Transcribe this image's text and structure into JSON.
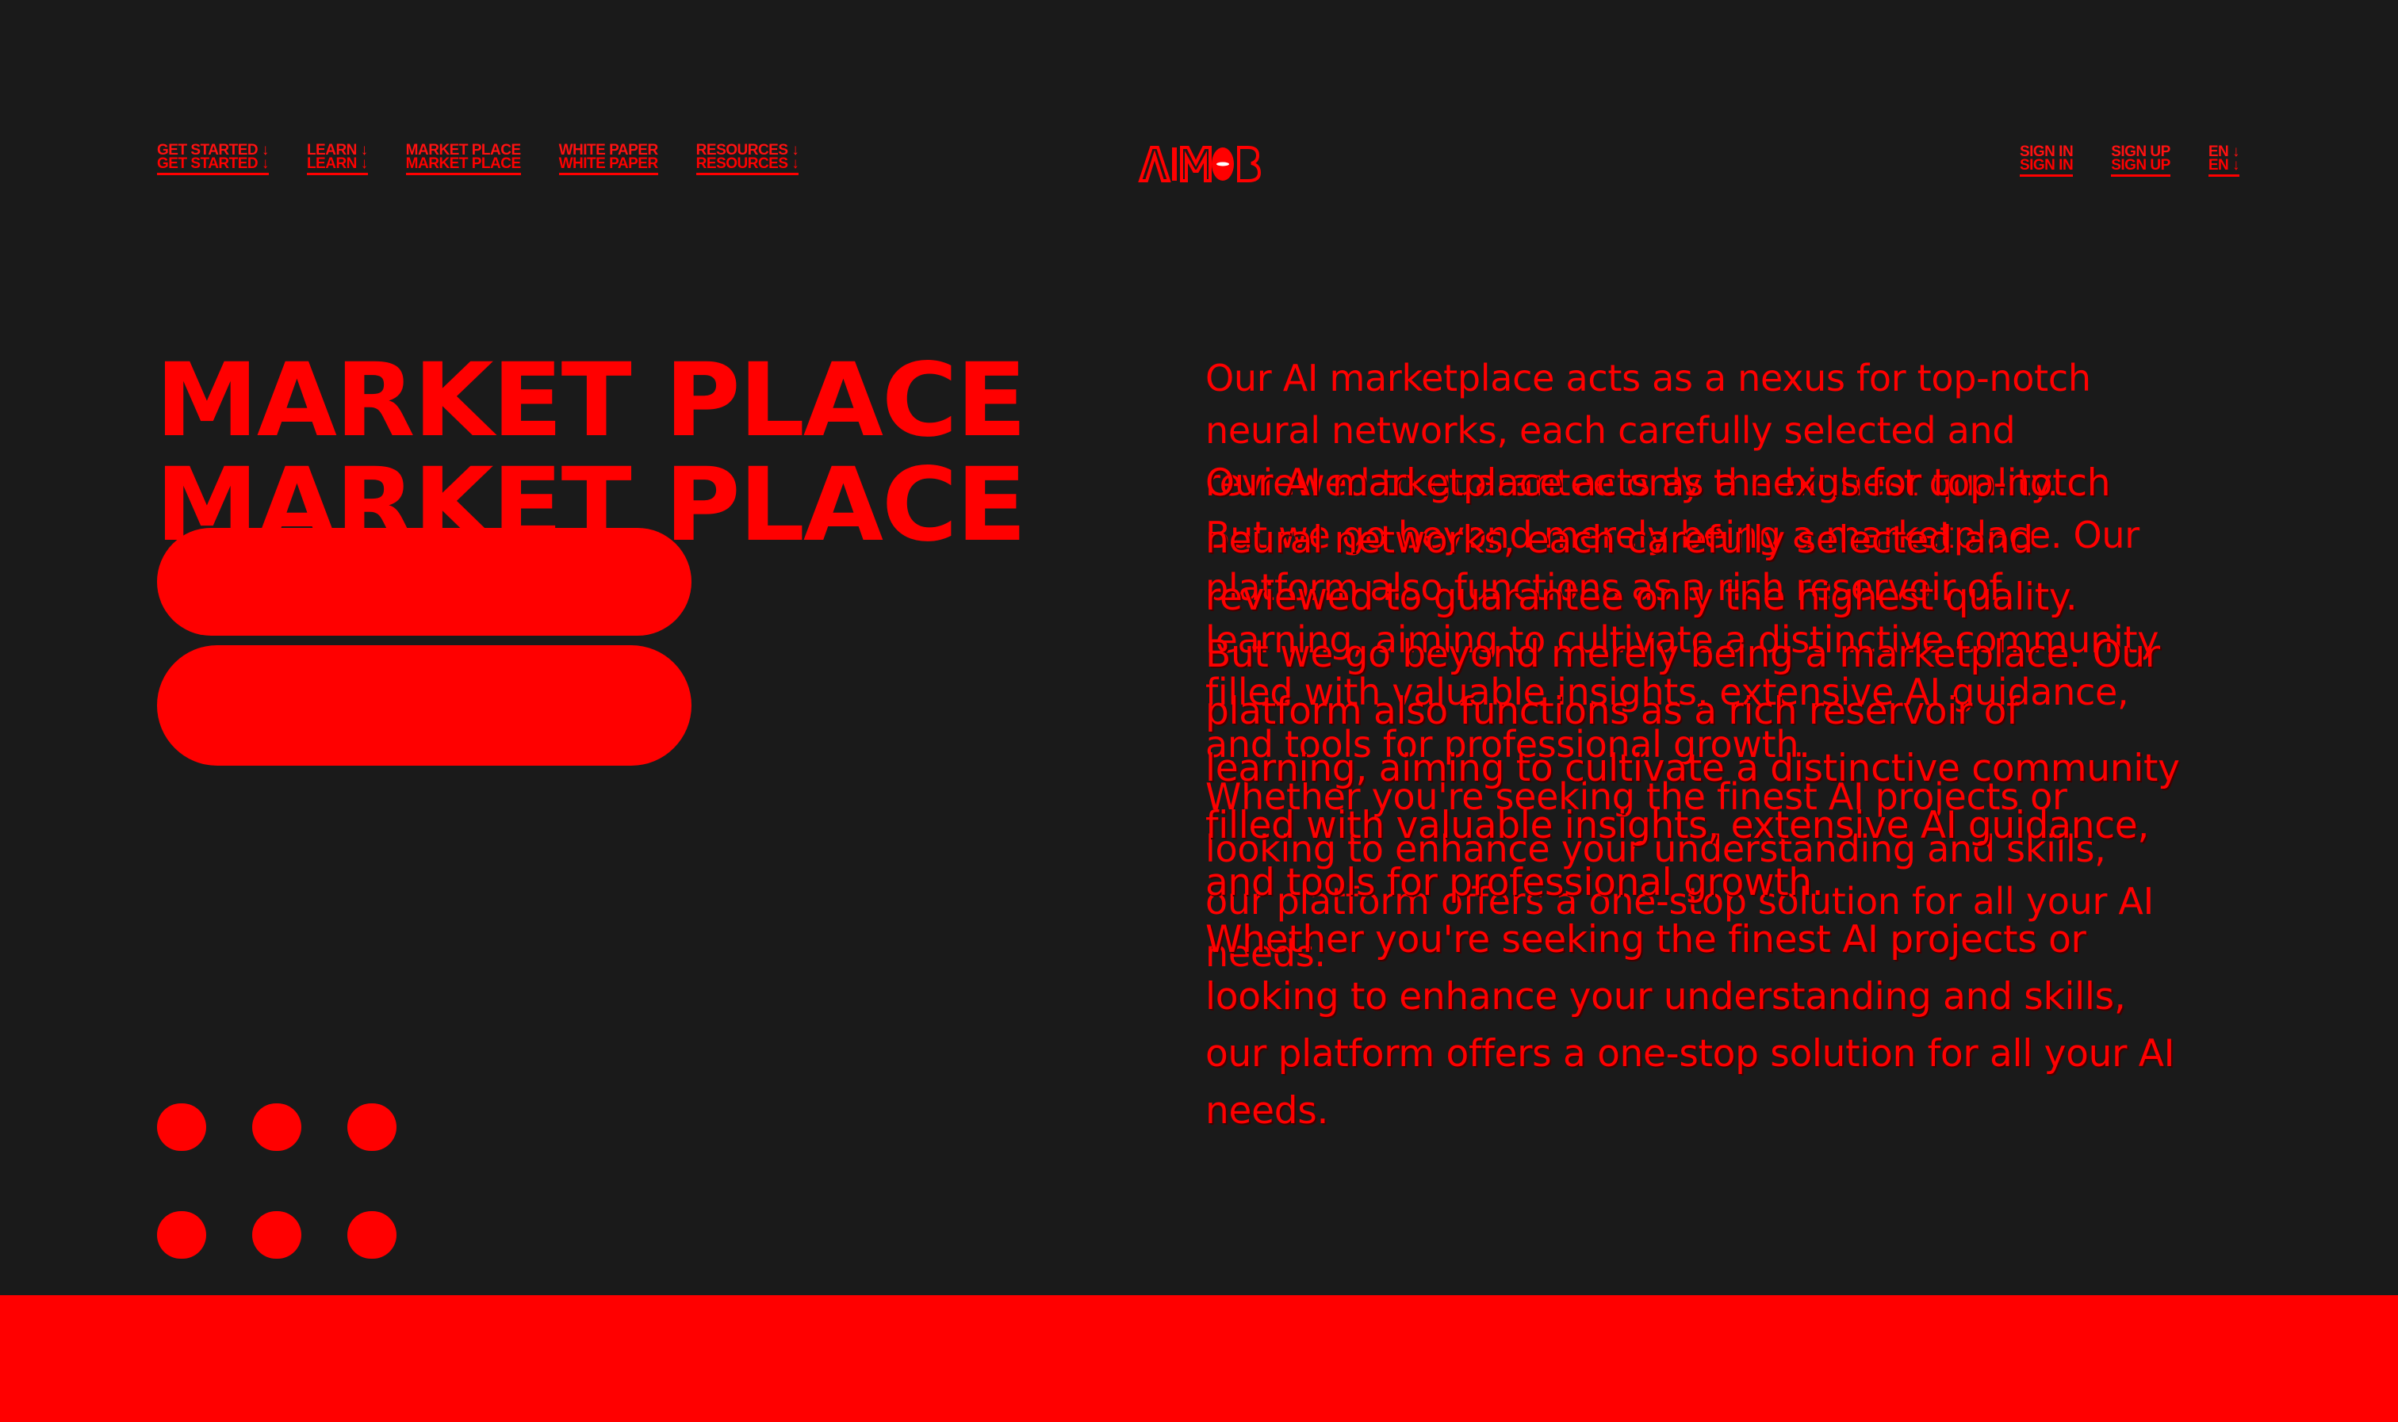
{
  "colors": {
    "background": "#1a1a1a",
    "accent": "#ff0000"
  },
  "nav_left": [
    {
      "label_a": "GET STARTED ↓",
      "label_b": "GET STARTED ↓"
    },
    {
      "label_a": "LEARN ↓",
      "label_b": "LEARN ↓"
    },
    {
      "label_a": "MARKET PLACE",
      "label_b": "MARKET PLACE"
    },
    {
      "label_a": "WHITE PAPER",
      "label_b": "WHITE PAPER"
    },
    {
      "label_a": "RESOURCES ↓",
      "label_b": "RESOURCES ↓"
    }
  ],
  "nav_right": [
    {
      "label_a": "SIGN IN",
      "label_b": "SIGN IN"
    },
    {
      "label_a": "SIGN UP",
      "label_b": "SIGN UP"
    },
    {
      "label_a": "EN ↓",
      "label_b": "EN ↓"
    }
  ],
  "logo": {
    "text": "AIMOB",
    "icon": "aimob-logo-icon"
  },
  "hero": {
    "title_line_1": "MARKET PLACE",
    "title_line_2": "MARKET PLACE"
  },
  "buttons": [
    {
      "label": ""
    },
    {
      "label": ""
    }
  ],
  "dots_count": 6,
  "copy": {
    "p1": "Our AI marketplace acts as a nexus for top-notch neural networks, each carefully selected and reviewed to guarantee only the highest quality.",
    "p1_lines": [
      "Our AI marketplace acts as a nexus for top-notch",
      "neural networks, each carefully selected and",
      "reviewed to guarantee only the highest quality."
    ],
    "p2_lines": [
      "But we go beyond merely being a marketplace. Our",
      "platform also functions as a rich reservoir of",
      "learning, aiming to cultivate a distinctive community",
      "filled with valuable insights, extensive AI guidance,",
      "and tools for professional growth."
    ],
    "p3_lines": [
      "Whether you're seeking the finest AI projects or",
      "looking to enhance your understanding and skills,",
      "our platform offers a one-stop solution for all your AI",
      "needs."
    ]
  }
}
